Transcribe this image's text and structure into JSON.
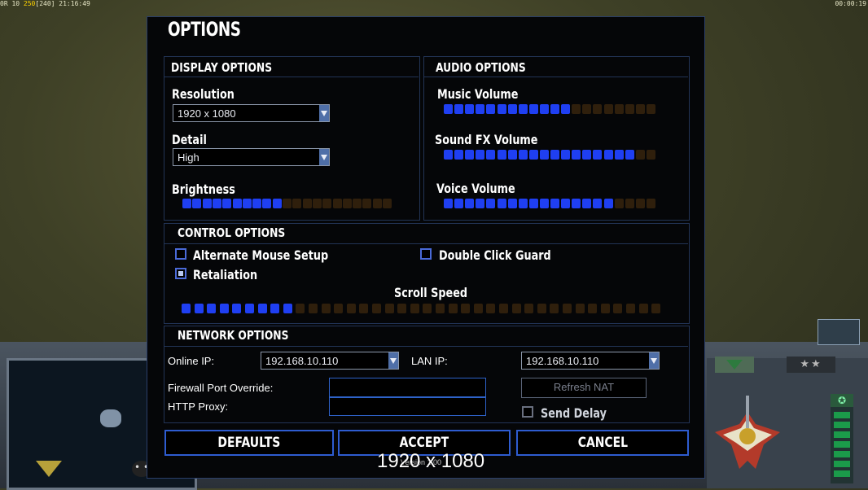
{
  "hud": {
    "left_prefix": "0R 10",
    "left_fps": "250",
    "left_suffix": "[240]",
    "left_clock": "21:16:49",
    "right_timer": "00:00:19"
  },
  "background_ui": {
    "rank_stars": "★★",
    "dots_label": "• •"
  },
  "options": {
    "title": "OPTIONS",
    "display": {
      "header": "DISPLAY OPTIONS",
      "resolution_label": "Resolution",
      "resolution_value": "1920 x 1080",
      "detail_label": "Detail",
      "detail_value": "High",
      "brightness_label": "Brightness",
      "brightness": {
        "level": 10,
        "total": 21
      }
    },
    "audio": {
      "header": "AUDIO OPTIONS",
      "music_label": "Music Volume",
      "music": {
        "level": 12,
        "total": 20
      },
      "sfx_label": "Sound FX Volume",
      "sfx": {
        "level": 18,
        "total": 20
      },
      "voice_label": "Voice Volume",
      "voice": {
        "level": 16,
        "total": 20
      }
    },
    "control": {
      "header": "CONTROL OPTIONS",
      "alt_mouse_label": "Alternate Mouse Setup",
      "alt_mouse_checked": false,
      "double_click_label": "Double Click Guard",
      "double_click_checked": false,
      "retaliation_label": "Retaliation",
      "retaliation_checked": true,
      "scroll_speed_label": "Scroll Speed",
      "scroll_speed": {
        "level": 9,
        "total": 38
      }
    },
    "network": {
      "header": "NETWORK OPTIONS",
      "online_ip_label": "Online IP:",
      "online_ip_value": "192.168.10.110",
      "lan_ip_label": "LAN IP:",
      "lan_ip_value": "192.168.10.110",
      "firewall_label": "Firewall Port Override:",
      "firewall_value": "",
      "proxy_label": "HTTP Proxy:",
      "proxy_value": "",
      "refresh_nat_label": "Refresh NAT",
      "send_delay_label": "Send Delay",
      "send_delay_checked": false
    },
    "buttons": {
      "defaults": "DEFAULTS",
      "accept": "ACCEPT",
      "cancel": "CANCEL"
    },
    "version": "Version 1.00",
    "resolution_overlay": "1920 x 1080"
  },
  "colors": {
    "segment_on": "#1f3ff2",
    "segment_off": "#2f1f0c",
    "panel_border": "#223456",
    "button_border": "#2e5cd0"
  }
}
